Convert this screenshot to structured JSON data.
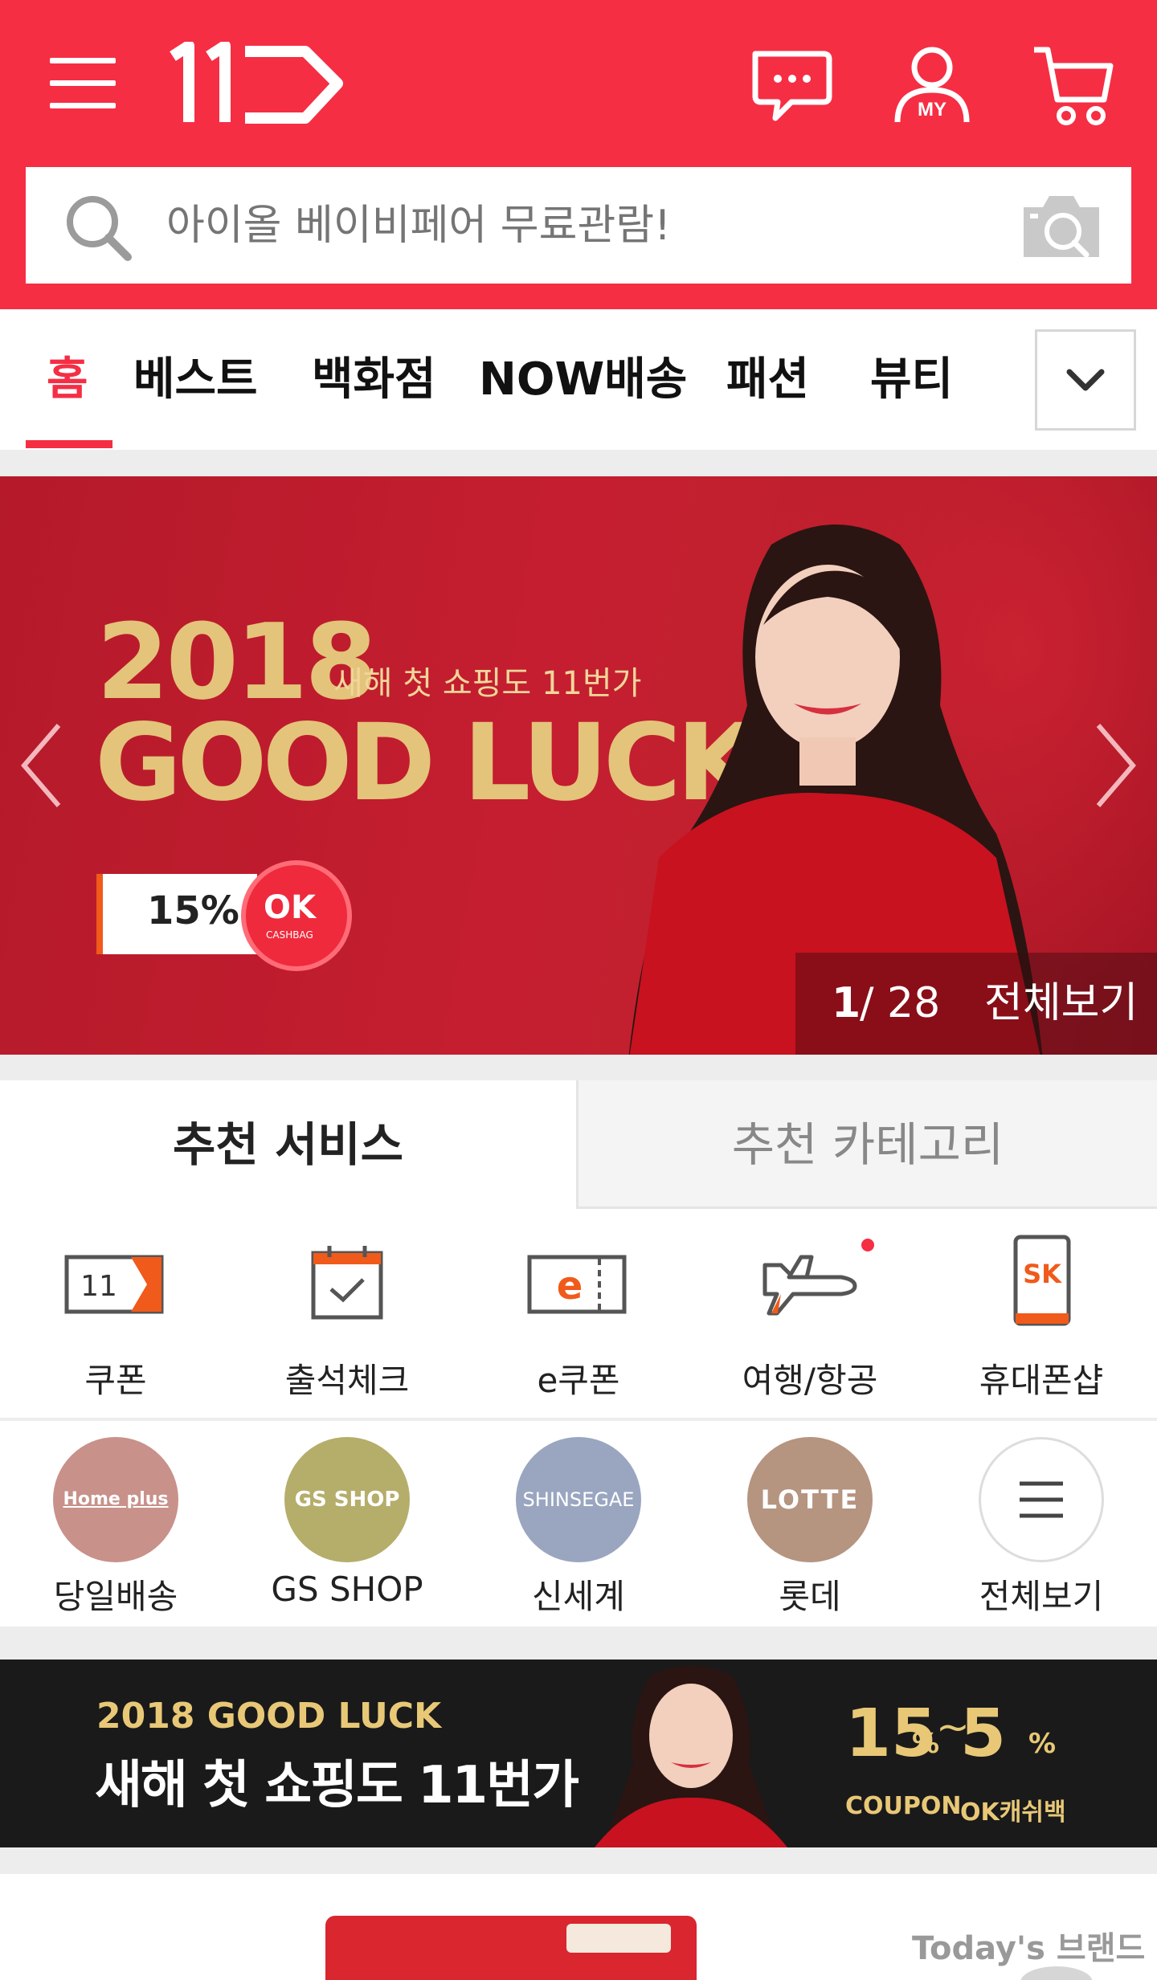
{
  "header": {
    "brand_color": "#f52e44",
    "logo_text": "11",
    "search_placeholder": "아이올 베이비페어 무료관람!",
    "icons": [
      "menu-icon",
      "chat-icon",
      "my-account-icon",
      "cart-icon",
      "search-icon",
      "camera-icon"
    ],
    "my_label": "MY"
  },
  "tabs": {
    "items": [
      "홈",
      "베스트",
      "백화점",
      "NOW배송",
      "패션",
      "뷰티"
    ],
    "active_index": 0
  },
  "banner": {
    "year": "2018",
    "subtitle": "새해 첫 쇼핑도 11번가",
    "title": "GOOD LUCK",
    "discount": "15%",
    "ok_text": "OK",
    "ok_small": "CASHBAG",
    "current": "1",
    "total": "/ 28",
    "view_all": "전체보기"
  },
  "recommend_tabs": {
    "active": "추천 서비스",
    "inactive": "추천 카테고리"
  },
  "services_row1": [
    {
      "label": "쿠폰",
      "icon": "coupon-icon"
    },
    {
      "label": "출석체크",
      "icon": "calendar-check-icon"
    },
    {
      "label": "e쿠폰",
      "icon": "e-coupon-icon"
    },
    {
      "label": "여행/항공",
      "icon": "airplane-icon"
    },
    {
      "label": "휴대폰샵",
      "icon": "phone-sk-icon"
    }
  ],
  "services_row2": [
    {
      "label": "당일배송",
      "logo": "Home plus",
      "color": "#c8918a"
    },
    {
      "label": "GS SHOP",
      "logo": "GS SHOP",
      "color": "#b5ad6a"
    },
    {
      "label": "신세계",
      "logo": "SHINSEGAE",
      "color": "#9aa6c0"
    },
    {
      "label": "롯데",
      "logo": "LOTTE",
      "color": "#b59480"
    },
    {
      "label": "전체보기",
      "logo": "",
      "color": "#ffffff"
    }
  ],
  "e_coupon_letter": "e",
  "sk_text": "SK",
  "coupon_number": "11",
  "promo": {
    "line1": "2018 GOOD LUCK",
    "line2": "새해 첫 쇼핑도 11번가",
    "pct1": "15",
    "pct1_suffix": "%",
    "tilde": "~",
    "pct2": "5",
    "pct2_suffix": "%",
    "cap1": "COUPON",
    "cap2": "OK캐쉬백"
  },
  "bottom": {
    "brand_label": "Today's 브랜드"
  }
}
